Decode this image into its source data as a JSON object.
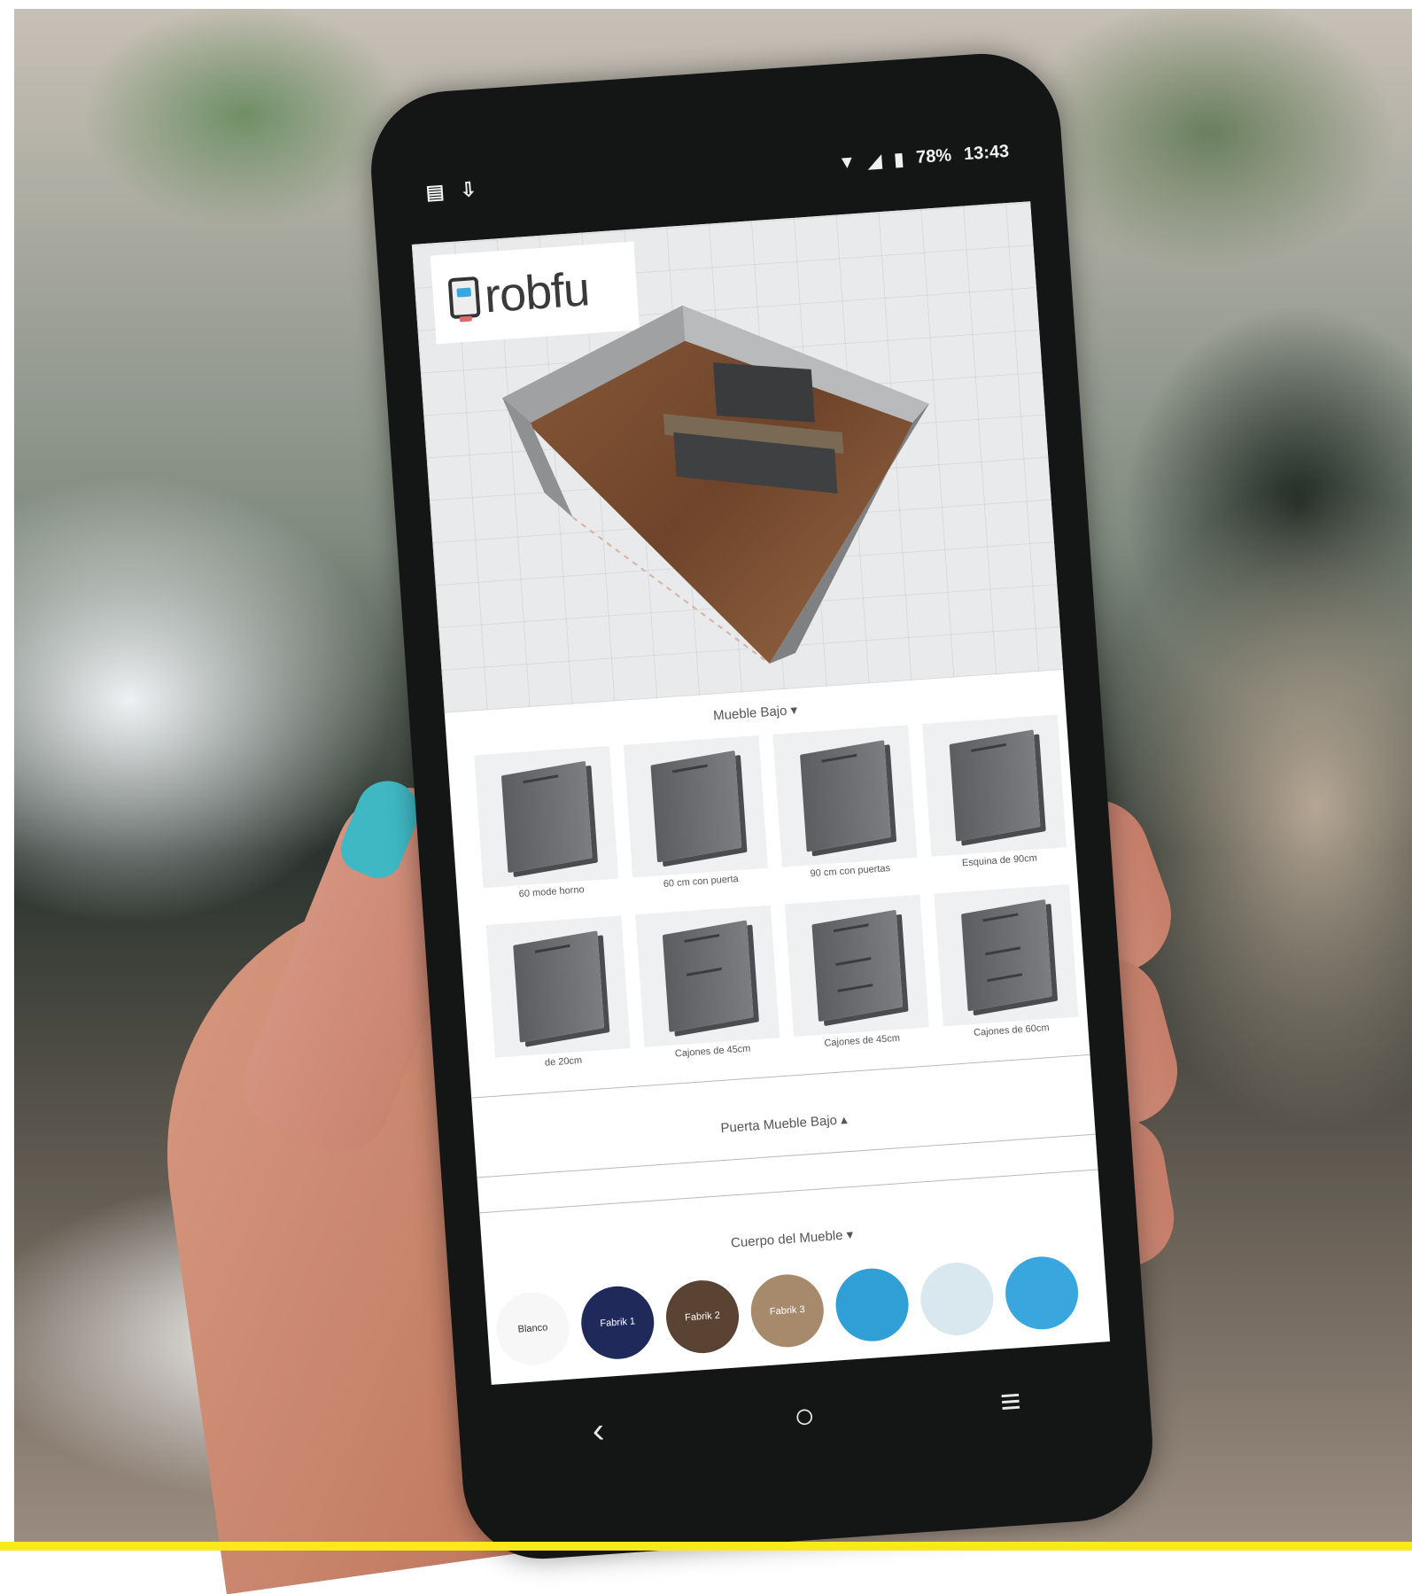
{
  "status_bar": {
    "battery_percent": "78%",
    "time": "13:43"
  },
  "app": {
    "logo_text": "robfu"
  },
  "sections": {
    "base_furniture": "Mueble Bajo",
    "base_door": "Puerta Mueble Bajo",
    "body": "Cuerpo del Mueble"
  },
  "cabinets": [
    {
      "label": "60 mode horno",
      "handles": 1
    },
    {
      "label": "60 cm con puerta",
      "handles": 1
    },
    {
      "label": "90 cm con puertas",
      "handles": 1
    },
    {
      "label": "Esquina de 90cm",
      "handles": 1
    },
    {
      "label": "de 20cm",
      "handles": 1
    },
    {
      "label": "Cajones de 45cm",
      "handles": 2
    },
    {
      "label": "Cajones de 45cm",
      "handles": 3
    },
    {
      "label": "Cajones de 60cm",
      "handles": 3
    }
  ],
  "swatches": [
    {
      "label": "Blanco",
      "color": "#f7f7f7",
      "text": "#333333"
    },
    {
      "label": "Fabrik 1",
      "color": "#1f2a5a",
      "text": "#ffffff"
    },
    {
      "label": "Fabrik 2",
      "color": "#5a4333",
      "text": "#ffffff"
    },
    {
      "label": "Fabrik 3",
      "color": "#a7896c",
      "text": "#ffffff"
    },
    {
      "label": "",
      "color": "#2f9fd6",
      "text": "#ffffff"
    },
    {
      "label": "",
      "color": "#d9e7ef",
      "text": "#333333"
    },
    {
      "label": "",
      "color": "#3aa6de",
      "text": "#ffffff"
    }
  ],
  "colors": {
    "accent_bar": "#fce81b",
    "nail": "#3fb8c3"
  }
}
